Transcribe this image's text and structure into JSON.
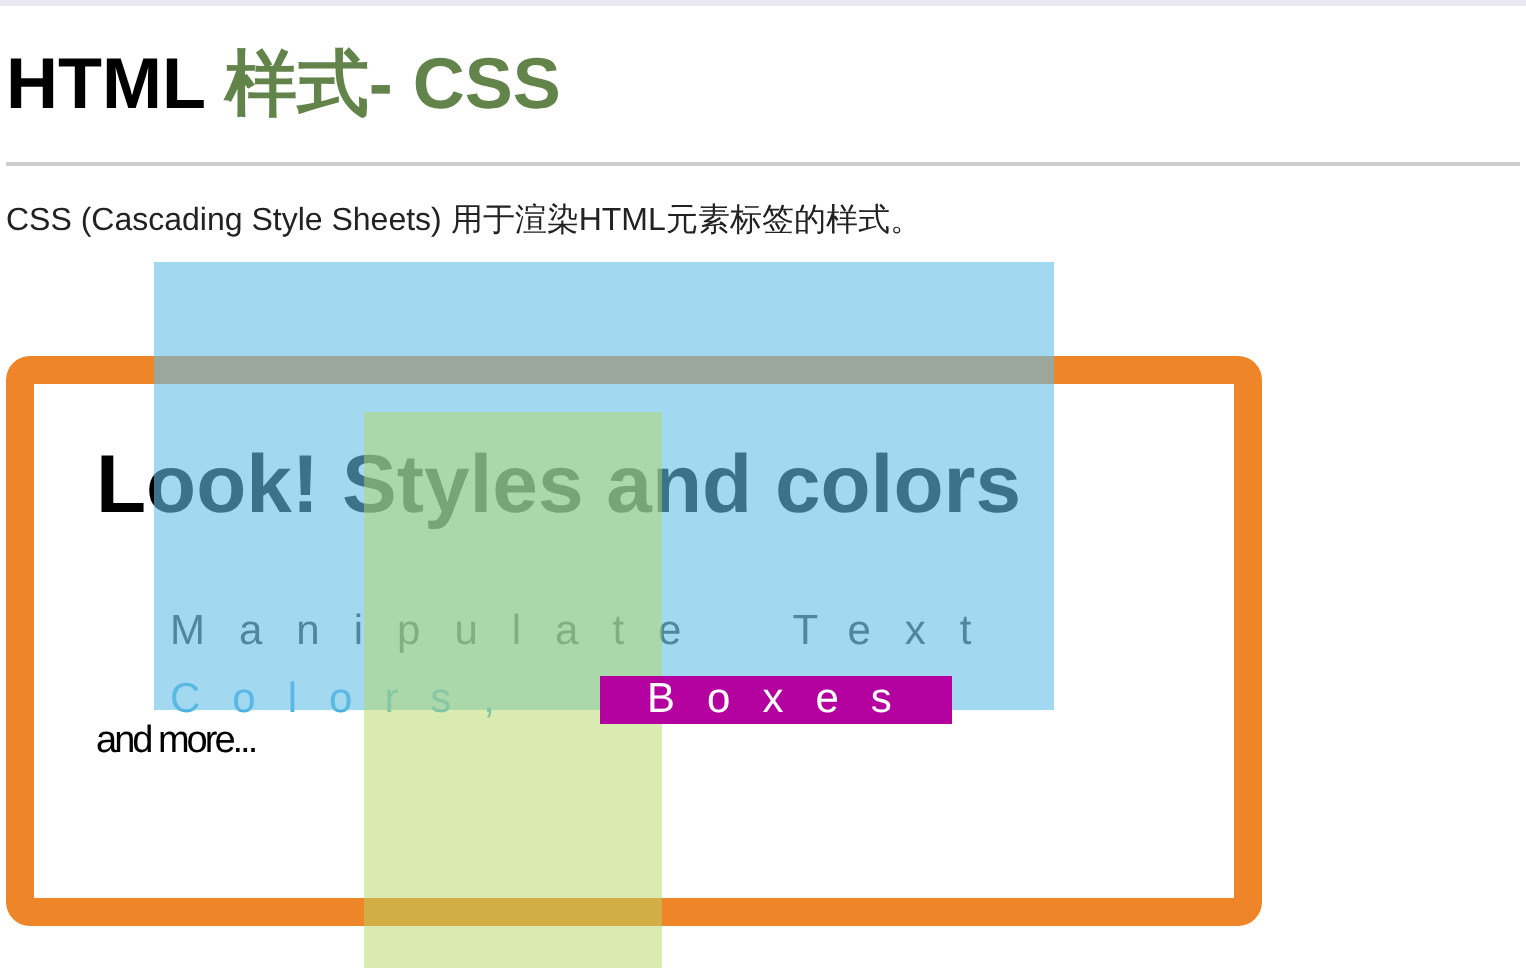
{
  "heading": {
    "plain": "HTML",
    "accent": "样式- CSS"
  },
  "intro": "CSS (Cascading Style Sheets) 用于渲染HTML元素标签的样式。",
  "demo": {
    "title": "Look! Styles and colors",
    "line": "Manipulate Text",
    "colors": "Colors,",
    "boxes": "Boxes",
    "more": "and more..."
  }
}
